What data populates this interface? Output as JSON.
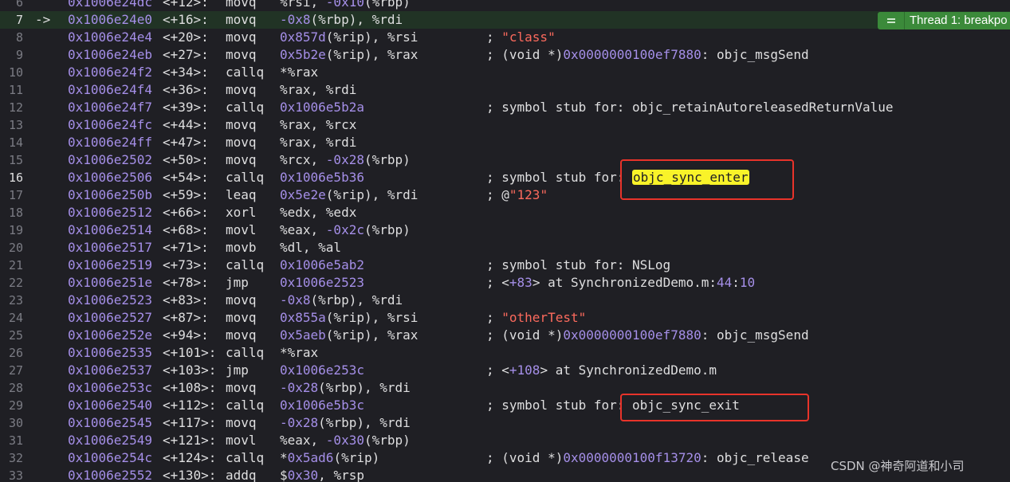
{
  "thread_badge": {
    "label": "Thread 1: breakpo",
    "icon": "breakpoint-lines-icon"
  },
  "watermark": "CSDN @神奇阿道和小司",
  "colors": {
    "background": "#1f1f24",
    "current_line": "#213325",
    "address": "#a58fe8",
    "string": "#fc6a5d",
    "highlight": "#f9f329",
    "annotation_box": "#e8332a",
    "badge": "#3b8a3a"
  },
  "lines": [
    {
      "n": "6",
      "arrow": "",
      "addr": "0x1006e24dc",
      "off": "<+12>:",
      "mnem": "movq",
      "ops": [
        {
          "t": "%rsi, "
        },
        {
          "t": "-0x10",
          "k": "num"
        },
        {
          "t": "(%rbp)"
        }
      ],
      "cmt": []
    },
    {
      "n": "7",
      "arrow": "->",
      "addr": "0x1006e24e0",
      "off": "<+16>:",
      "mnem": "movq",
      "ops": [
        {
          "t": "-0x8",
          "k": "num"
        },
        {
          "t": "(%rbp), %rdi"
        }
      ],
      "cmt": []
    },
    {
      "n": "8",
      "arrow": "",
      "addr": "0x1006e24e4",
      "off": "<+20>:",
      "mnem": "movq",
      "ops": [
        {
          "t": "0x857d",
          "k": "num"
        },
        {
          "t": "(%rip), %rsi"
        }
      ],
      "cmt": [
        {
          "t": "; "
        },
        {
          "t": "\"class\"",
          "k": "str"
        }
      ]
    },
    {
      "n": "9",
      "arrow": "",
      "addr": "0x1006e24eb",
      "off": "<+27>:",
      "mnem": "movq",
      "ops": [
        {
          "t": "0x5b2e",
          "k": "num"
        },
        {
          "t": "(%rip), %rax"
        }
      ],
      "cmt": [
        {
          "t": "; (void *)"
        },
        {
          "t": "0x0000000100ef7880",
          "k": "num"
        },
        {
          "t": ": objc_msgSend"
        }
      ]
    },
    {
      "n": "10",
      "arrow": "",
      "addr": "0x1006e24f2",
      "off": "<+34>:",
      "mnem": "callq",
      "ops": [
        {
          "t": "*%rax"
        }
      ],
      "cmt": []
    },
    {
      "n": "11",
      "arrow": "",
      "addr": "0x1006e24f4",
      "off": "<+36>:",
      "mnem": "movq",
      "ops": [
        {
          "t": "%rax, %rdi"
        }
      ],
      "cmt": []
    },
    {
      "n": "12",
      "arrow": "",
      "addr": "0x1006e24f7",
      "off": "<+39>:",
      "mnem": "callq",
      "ops": [
        {
          "t": "0x1006e5b2a",
          "k": "num"
        }
      ],
      "cmt": [
        {
          "t": "; symbol stub for: objc_retainAutoreleasedReturnValue"
        }
      ]
    },
    {
      "n": "13",
      "arrow": "",
      "addr": "0x1006e24fc",
      "off": "<+44>:",
      "mnem": "movq",
      "ops": [
        {
          "t": "%rax, %rcx"
        }
      ],
      "cmt": []
    },
    {
      "n": "14",
      "arrow": "",
      "addr": "0x1006e24ff",
      "off": "<+47>:",
      "mnem": "movq",
      "ops": [
        {
          "t": "%rax, %rdi"
        }
      ],
      "cmt": []
    },
    {
      "n": "15",
      "arrow": "",
      "addr": "0x1006e2502",
      "off": "<+50>:",
      "mnem": "movq",
      "ops": [
        {
          "t": "%rcx, "
        },
        {
          "t": "-0x28",
          "k": "num"
        },
        {
          "t": "(%rbp)"
        }
      ],
      "cmt": []
    },
    {
      "n": "16",
      "arrow": "",
      "addr": "0x1006e2506",
      "off": "<+54>:",
      "mnem": "callq",
      "ops": [
        {
          "t": "0x1006e5b36",
          "k": "num"
        }
      ],
      "cmt": [
        {
          "t": "; symbol stub for: "
        },
        {
          "t": "objc_sync_enter",
          "k": "hl"
        }
      ]
    },
    {
      "n": "17",
      "arrow": "",
      "addr": "0x1006e250b",
      "off": "<+59>:",
      "mnem": "leaq",
      "ops": [
        {
          "t": "0x5e2e",
          "k": "num"
        },
        {
          "t": "(%rip), %rdi"
        }
      ],
      "cmt": [
        {
          "t": "; @"
        },
        {
          "t": "\"123\"",
          "k": "str"
        }
      ]
    },
    {
      "n": "18",
      "arrow": "",
      "addr": "0x1006e2512",
      "off": "<+66>:",
      "mnem": "xorl",
      "ops": [
        {
          "t": "%edx, %edx"
        }
      ],
      "cmt": []
    },
    {
      "n": "19",
      "arrow": "",
      "addr": "0x1006e2514",
      "off": "<+68>:",
      "mnem": "movl",
      "ops": [
        {
          "t": "%eax, "
        },
        {
          "t": "-0x2c",
          "k": "num"
        },
        {
          "t": "(%rbp)"
        }
      ],
      "cmt": []
    },
    {
      "n": "20",
      "arrow": "",
      "addr": "0x1006e2517",
      "off": "<+71>:",
      "mnem": "movb",
      "ops": [
        {
          "t": "%dl, %al"
        }
      ],
      "cmt": []
    },
    {
      "n": "21",
      "arrow": "",
      "addr": "0x1006e2519",
      "off": "<+73>:",
      "mnem": "callq",
      "ops": [
        {
          "t": "0x1006e5ab2",
          "k": "num"
        }
      ],
      "cmt": [
        {
          "t": "; symbol stub for: NSLog"
        }
      ]
    },
    {
      "n": "22",
      "arrow": "",
      "addr": "0x1006e251e",
      "off": "<+78>:",
      "mnem": "jmp",
      "ops": [
        {
          "t": "0x1006e2523",
          "k": "num"
        }
      ],
      "cmt": [
        {
          "t": "; <"
        },
        {
          "t": "+83",
          "k": "num"
        },
        {
          "t": "> at SynchronizedDemo.m:"
        },
        {
          "t": "44",
          "k": "num"
        },
        {
          "t": ":"
        },
        {
          "t": "10",
          "k": "num"
        }
      ]
    },
    {
      "n": "23",
      "arrow": "",
      "addr": "0x1006e2523",
      "off": "<+83>:",
      "mnem": "movq",
      "ops": [
        {
          "t": "-0x8",
          "k": "num"
        },
        {
          "t": "(%rbp), %rdi"
        }
      ],
      "cmt": []
    },
    {
      "n": "24",
      "arrow": "",
      "addr": "0x1006e2527",
      "off": "<+87>:",
      "mnem": "movq",
      "ops": [
        {
          "t": "0x855a",
          "k": "num"
        },
        {
          "t": "(%rip), %rsi"
        }
      ],
      "cmt": [
        {
          "t": "; "
        },
        {
          "t": "\"otherTest\"",
          "k": "str"
        }
      ]
    },
    {
      "n": "25",
      "arrow": "",
      "addr": "0x1006e252e",
      "off": "<+94>:",
      "mnem": "movq",
      "ops": [
        {
          "t": "0x5aeb",
          "k": "num"
        },
        {
          "t": "(%rip), %rax"
        }
      ],
      "cmt": [
        {
          "t": "; (void *)"
        },
        {
          "t": "0x0000000100ef7880",
          "k": "num"
        },
        {
          "t": ": objc_msgSend"
        }
      ]
    },
    {
      "n": "26",
      "arrow": "",
      "addr": "0x1006e2535",
      "off": "<+101>:",
      "mnem": "callq",
      "ops": [
        {
          "t": "*%rax"
        }
      ],
      "cmt": []
    },
    {
      "n": "27",
      "arrow": "",
      "addr": "0x1006e2537",
      "off": "<+103>:",
      "mnem": "jmp",
      "ops": [
        {
          "t": "0x1006e253c",
          "k": "num"
        }
      ],
      "cmt": [
        {
          "t": "; <"
        },
        {
          "t": "+108",
          "k": "num"
        },
        {
          "t": "> at SynchronizedDemo.m"
        }
      ]
    },
    {
      "n": "28",
      "arrow": "",
      "addr": "0x1006e253c",
      "off": "<+108>:",
      "mnem": "movq",
      "ops": [
        {
          "t": "-0x28",
          "k": "num"
        },
        {
          "t": "(%rbp), %rdi"
        }
      ],
      "cmt": []
    },
    {
      "n": "29",
      "arrow": "",
      "addr": "0x1006e2540",
      "off": "<+112>:",
      "mnem": "callq",
      "ops": [
        {
          "t": "0x1006e5b3c",
          "k": "num"
        }
      ],
      "cmt": [
        {
          "t": "; symbol stub for: objc_sync_exit"
        }
      ]
    },
    {
      "n": "30",
      "arrow": "",
      "addr": "0x1006e2545",
      "off": "<+117>:",
      "mnem": "movq",
      "ops": [
        {
          "t": "-0x28",
          "k": "num"
        },
        {
          "t": "(%rbp), %rdi"
        }
      ],
      "cmt": []
    },
    {
      "n": "31",
      "arrow": "",
      "addr": "0x1006e2549",
      "off": "<+121>:",
      "mnem": "movl",
      "ops": [
        {
          "t": "%eax, "
        },
        {
          "t": "-0x30",
          "k": "num"
        },
        {
          "t": "(%rbp)"
        }
      ],
      "cmt": []
    },
    {
      "n": "32",
      "arrow": "",
      "addr": "0x1006e254c",
      "off": "<+124>:",
      "mnem": "callq",
      "ops": [
        {
          "t": "*"
        },
        {
          "t": "0x5ad6",
          "k": "num"
        },
        {
          "t": "(%rip)"
        }
      ],
      "cmt": [
        {
          "t": "; (void *)"
        },
        {
          "t": "0x0000000100f13720",
          "k": "num"
        },
        {
          "t": ": objc_release"
        }
      ]
    },
    {
      "n": "33",
      "arrow": "",
      "addr": "0x1006e2552",
      "off": "<+130>:",
      "mnem": "addq",
      "ops": [
        {
          "t": "$"
        },
        {
          "t": "0x30",
          "k": "num"
        },
        {
          "t": ", %rsp"
        }
      ],
      "cmt": []
    }
  ]
}
